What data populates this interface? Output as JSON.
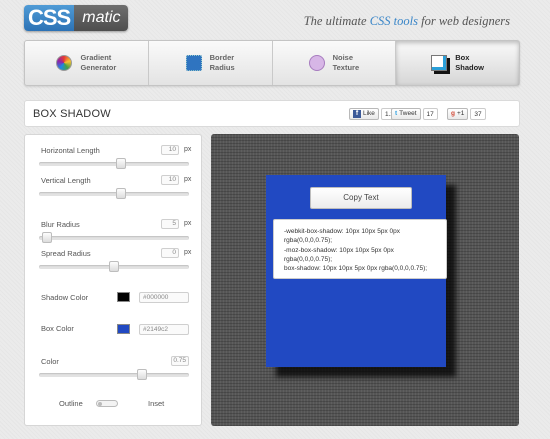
{
  "brand": {
    "logo_css": "CSS",
    "logo_matic": "matic"
  },
  "tagline": {
    "pre": "The ultimate ",
    "highlight": "CSS tools",
    "post": " for web designers"
  },
  "tabs": [
    {
      "label1": "Gradient",
      "label2": "Generator",
      "icon": "gradient-icon"
    },
    {
      "label1": "Border",
      "label2": "Radius",
      "icon": "border-radius-icon"
    },
    {
      "label1": "Noise",
      "label2": "Texture",
      "icon": "noise-icon"
    },
    {
      "label1": "Box",
      "label2": "Shadow",
      "icon": "box-shadow-icon",
      "active": true
    }
  ],
  "page_title": "BOX SHADOW",
  "social": {
    "facebook_label": "Like",
    "facebook_count": "1.2k",
    "twitter_label": "Tweet",
    "twitter_count": "17",
    "gplus_label": "+1",
    "gplus_count": "37"
  },
  "controls": {
    "horizontal_length": {
      "label": "Horizontal Length",
      "value": "10",
      "unit": "px",
      "slider": 0.55
    },
    "vertical_length": {
      "label": "Vertical Length",
      "value": "10",
      "unit": "px",
      "slider": 0.55
    },
    "blur_radius": {
      "label": "Blur Radius",
      "value": "5",
      "unit": "px",
      "slider": 0.02
    },
    "spread_radius": {
      "label": "Spread Radius",
      "value": "0",
      "unit": "px",
      "slider": 0.5
    },
    "shadow_color": {
      "label": "Shadow Color",
      "hex": "#000000",
      "color": "#000000"
    },
    "box_color": {
      "label": "Box Color",
      "hex": "#2149c2",
      "color": "#2149c2"
    },
    "opacity": {
      "label": "Color",
      "value": "0.75",
      "slider": 0.7
    },
    "outline_label": "Outline",
    "inset_label": "Inset"
  },
  "preview": {
    "copy_button": "Copy Text",
    "code": [
      "-webkit-box-shadow: 10px 10px 5px 0px",
      "rgba(0,0,0,0.75);",
      "-moz-box-shadow: 10px 10px 5px 0px",
      "rgba(0,0,0,0.75);",
      "box-shadow: 10px 10px 5px 0px rgba(0,0,0,0.75);"
    ]
  }
}
